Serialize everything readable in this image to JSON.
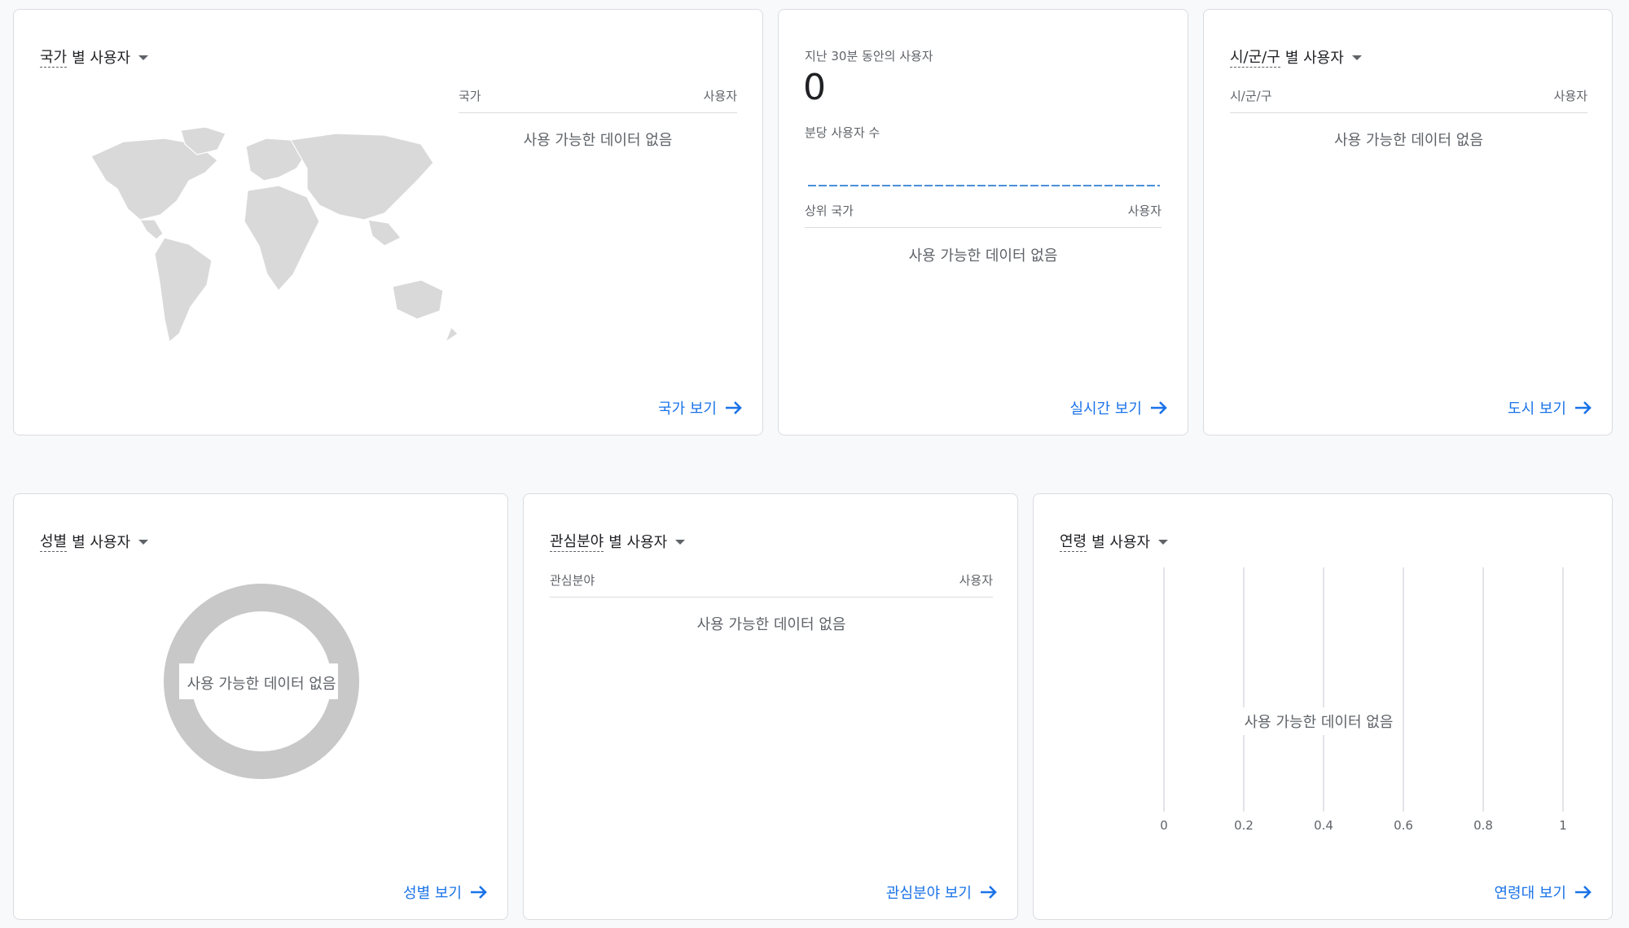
{
  "country_card": {
    "title_dim": "국가",
    "title_rest": "별 사용자",
    "col_dimension": "국가",
    "col_metric": "사용자",
    "no_data": "사용 가능한 데이터 없음",
    "link": "국가 보기",
    "map_color": "#d9d9d9"
  },
  "realtime_card": {
    "label": "지난 30분 동안의 사용자",
    "count": "0",
    "per_minute_label": "분당 사용자 수",
    "col_dimension": "상위 국가",
    "col_metric": "사용자",
    "no_data": "사용 가능한 데이터 없음",
    "link": "실시간 보기",
    "sparkline_color": "#4a90d9"
  },
  "city_card": {
    "title_dim": "시/군/구",
    "title_rest": "별 사용자",
    "col_dimension": "시/군/구",
    "col_metric": "사용자",
    "no_data": "사용 가능한 데이터 없음",
    "link": "도시 보기"
  },
  "gender_card": {
    "title_dim": "성별",
    "title_rest": "별 사용자",
    "no_data": "사용 가능한 데이터 없음",
    "link": "성별 보기",
    "donut_color": "#c8c8c8"
  },
  "interest_card": {
    "title_dim": "관심분야",
    "title_rest": "별 사용자",
    "col_dimension": "관심분야",
    "col_metric": "사용자",
    "no_data": "사용 가능한 데이터 없음",
    "link": "관심분야 보기"
  },
  "age_card": {
    "title_dim": "연령",
    "title_rest": "별 사용자",
    "no_data": "사용 가능한 데이터 없음",
    "link": "연령대 보기",
    "ticks": [
      "0",
      "0.2",
      "0.4",
      "0.6",
      "0.8",
      "1"
    ]
  },
  "colors": {
    "link": "#1a73e8",
    "text": "#3c4043",
    "muted": "#5f6368",
    "border": "#dadce0"
  }
}
